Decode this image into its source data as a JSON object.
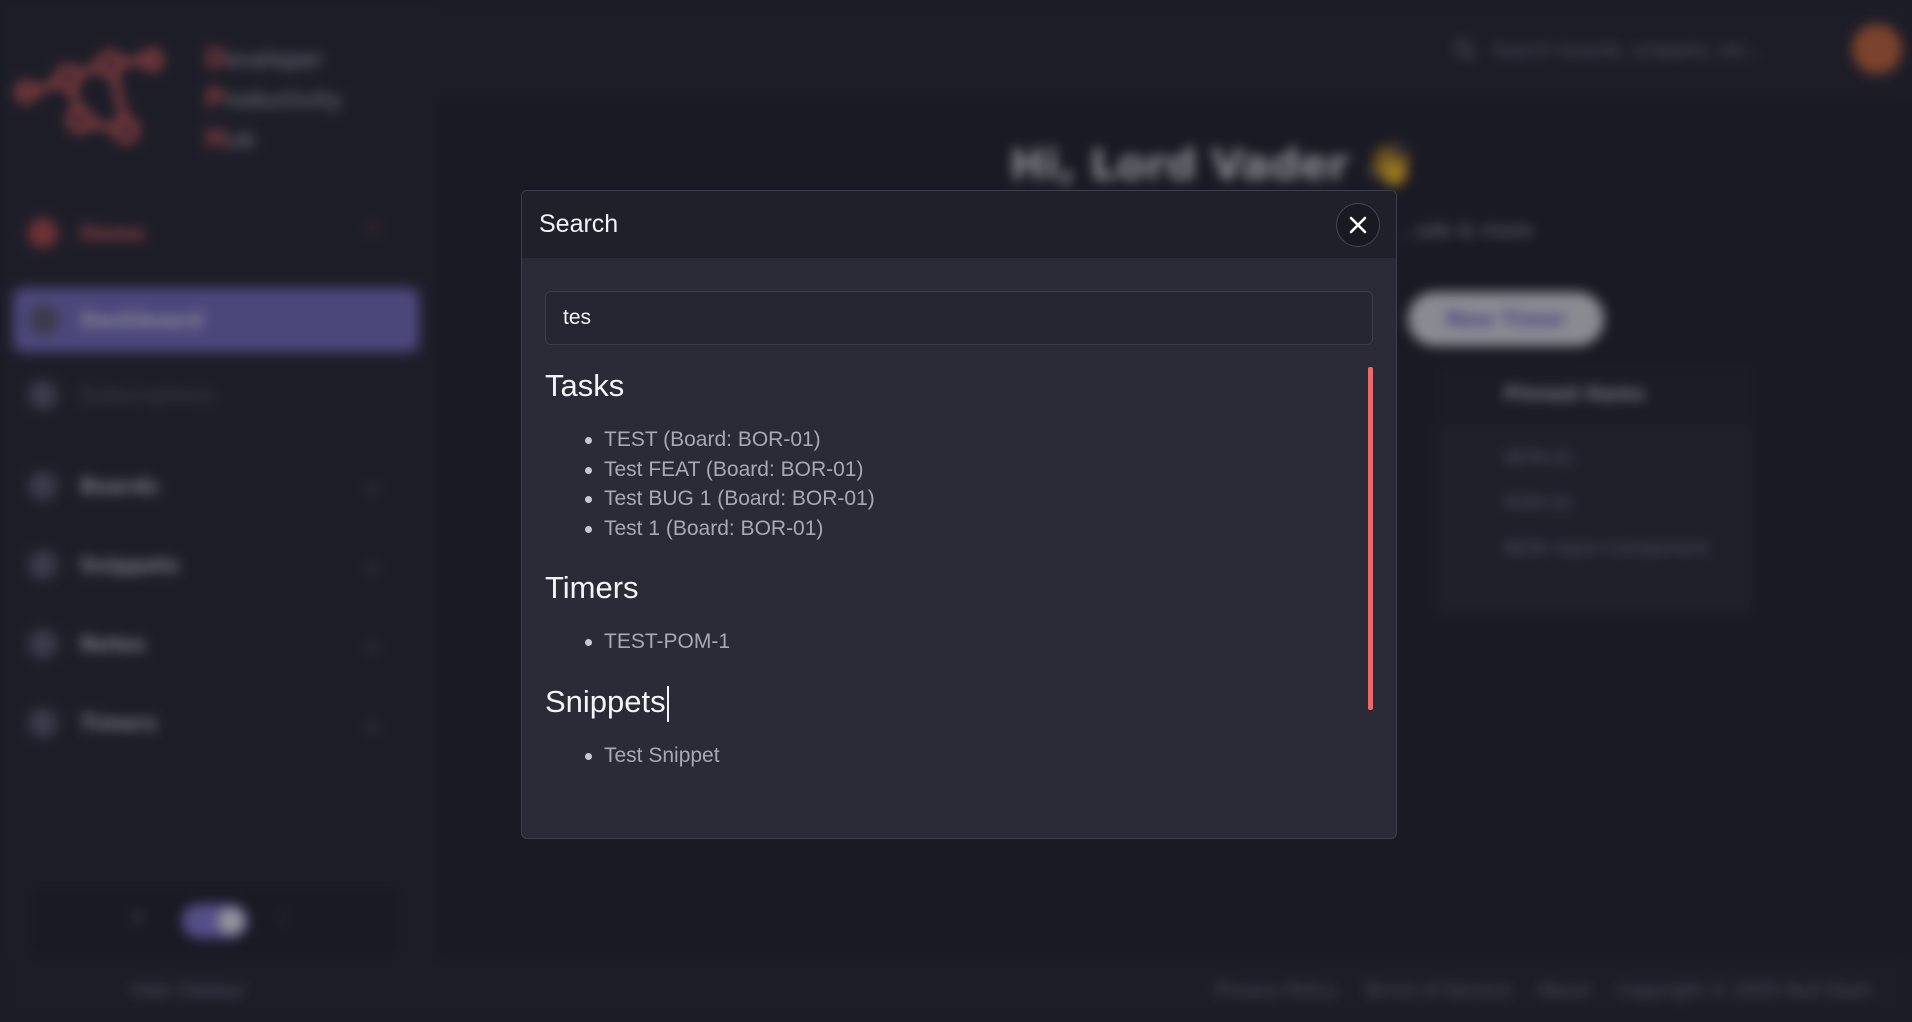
{
  "background": {
    "brand": [
      {
        "cap": "D",
        "rest": "eveloper"
      },
      {
        "cap": "P",
        "rest": "roductivity"
      },
      {
        "cap": "H",
        "rest": "ub"
      }
    ],
    "sidebar": {
      "items": [
        {
          "label": "Home",
          "icon": "home-icon"
        },
        {
          "label": "Dashboard",
          "icon": "dashboard-icon"
        },
        {
          "label": "Subscriptions",
          "icon": "subscriptions-icon"
        },
        {
          "label": "Boards",
          "icon": "boards-icon"
        },
        {
          "label": "Snippets",
          "icon": "snippets-icon"
        },
        {
          "label": "Notes",
          "icon": "notes-icon"
        },
        {
          "label": "Timers",
          "icon": "timers-icon"
        }
      ],
      "hide_label": "Hide Sidebar"
    },
    "topbar": {
      "search_placeholder": "Search boards, snippets, etc..."
    },
    "main": {
      "greeting": "Hi, Lord Vader 👋",
      "subtitle": "...ods & more",
      "new_timer": "New Timer",
      "pinned_title": "Pinned Items",
      "pinned_items": [
        "INTR-01",
        "POM-01",
        "NEW Input Component"
      ]
    },
    "footer": {
      "links": [
        "Privacy Policy",
        "Terms of Service",
        "About",
        "Copyright © 2025 Null Dash"
      ]
    }
  },
  "modal": {
    "title": "Search",
    "query": "tes",
    "sections": [
      {
        "title": "Tasks",
        "items": [
          "TEST (Board: BOR-01)",
          "Test FEAT (Board: BOR-01)",
          "Test BUG 1 (Board: BOR-01)",
          "Test 1 (Board: BOR-01)"
        ]
      },
      {
        "title": "Timers",
        "items": [
          "TEST-POM-1"
        ]
      },
      {
        "title": "Snippets",
        "items": [
          "Test Snippet"
        ]
      }
    ]
  },
  "colors": {
    "accent": "#7b72c8",
    "brand_red": "#e8645f",
    "scrollbar": "#ea6a6a",
    "modal_bg": "#2b2b38"
  }
}
